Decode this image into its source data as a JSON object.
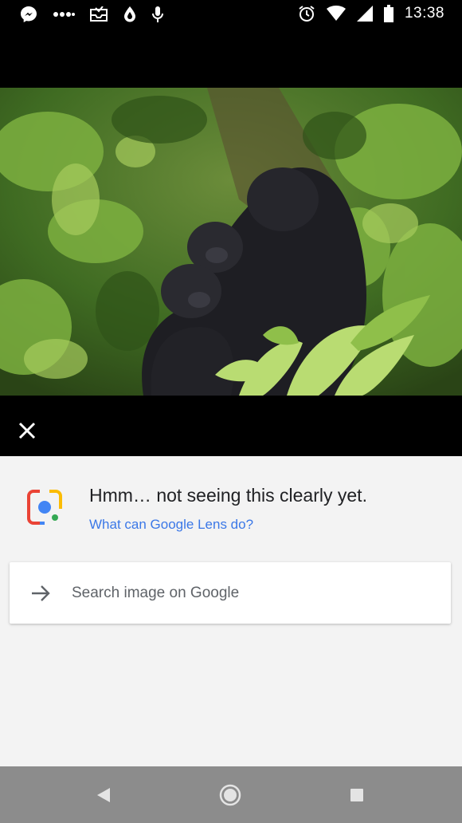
{
  "status_bar": {
    "time": "13:38",
    "left_icons": [
      "messenger-icon",
      "more-dots-icon",
      "gmail-inbox-icon",
      "drop-icon",
      "microphone-icon"
    ],
    "right_icons": [
      "alarm-icon",
      "wifi-icon",
      "signal-icon",
      "battery-icon"
    ]
  },
  "photo": {
    "subject": "gorilla-photo",
    "colors": {
      "foliage": "#5c8a2e",
      "dark_foliage": "#2d4a18",
      "gorilla": "#1f1f24"
    }
  },
  "overlay": {
    "close_icon": "close-icon"
  },
  "sheet": {
    "headline": "Hmm… not seeing this clearly yet.",
    "lens_link": "What can Google Lens do?",
    "search_label": "Search image on Google",
    "lens_colors": {
      "blue": "#4285f4",
      "red": "#ea4335",
      "yellow": "#fbbc04",
      "green": "#34a853"
    }
  },
  "nav_bar": {
    "buttons": [
      "back-icon",
      "home-icon",
      "recents-icon"
    ]
  }
}
